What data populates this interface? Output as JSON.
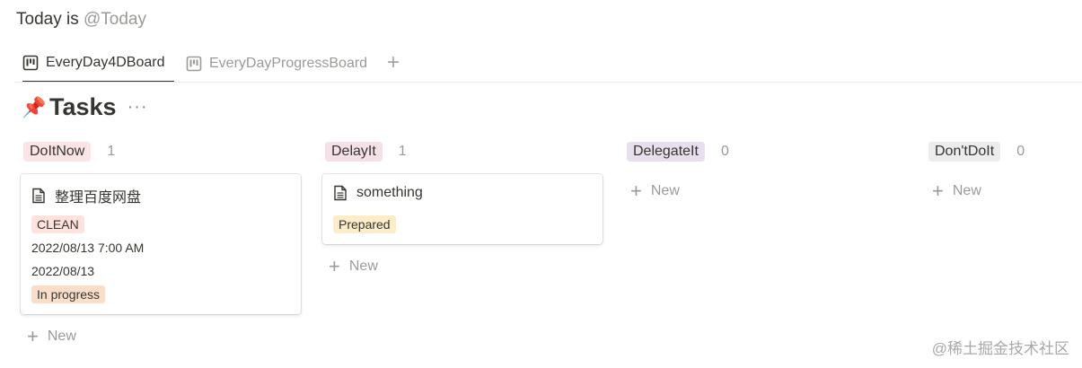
{
  "header": {
    "today_prefix": "Today is",
    "today_mention": "@Today"
  },
  "tabs": [
    {
      "label": "EveryDay4DBoard",
      "active": true
    },
    {
      "label": "EveryDayProgressBoard",
      "active": false
    }
  ],
  "tab_add": "+",
  "database": {
    "icon": "📌",
    "title": "Tasks",
    "more": "···"
  },
  "columns": [
    {
      "label": "DoItNow",
      "count": "1"
    },
    {
      "label": "DelayIt",
      "count": "1"
    },
    {
      "label": "DelegateIt",
      "count": "0"
    },
    {
      "label": "Don'tDoIt",
      "count": "0"
    }
  ],
  "cards": [
    {
      "title": "整理百度网盘",
      "tag": "CLEAN",
      "datetime": "2022/08/13 7:00 AM",
      "date": "2022/08/13",
      "status": "In progress"
    },
    {
      "title": "something",
      "tag": "Prepared"
    }
  ],
  "new_label": "New",
  "watermark": "@稀土掘金技术社区"
}
